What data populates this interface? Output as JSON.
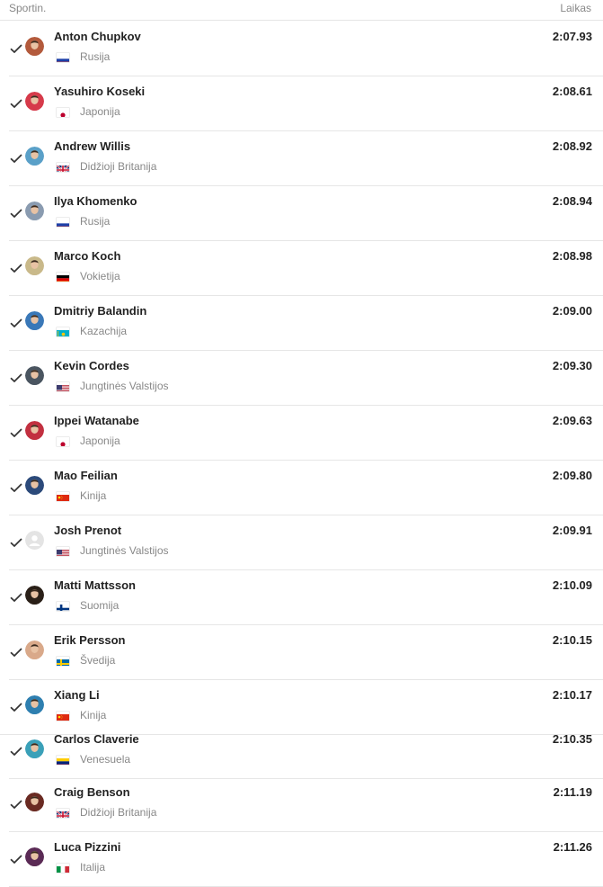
{
  "header": {
    "athlete_label": "Sportin.",
    "time_label": "Laikas"
  },
  "rows": [
    {
      "name": "Anton Chupkov",
      "country": "Rusija",
      "time": "2:07.93",
      "flag": "russia",
      "avatar_color": "#b35a3c",
      "avatar_icon": "athlete-photo-icon"
    },
    {
      "name": "Yasuhiro Koseki",
      "country": "Japonija",
      "time": "2:08.61",
      "flag": "japan",
      "avatar_color": "#d63a4a",
      "avatar_icon": "athlete-photo-icon"
    },
    {
      "name": "Andrew Willis",
      "country": "Didžioji Britanija",
      "time": "2:08.92",
      "flag": "uk",
      "avatar_color": "#5aa0c8",
      "avatar_icon": "athlete-photo-icon"
    },
    {
      "name": "Ilya Khomenko",
      "country": "Rusija",
      "time": "2:08.94",
      "flag": "russia",
      "avatar_color": "#8a9bb0",
      "avatar_icon": "athlete-photo-icon"
    },
    {
      "name": "Marco Koch",
      "country": "Vokietija",
      "time": "2:08.98",
      "flag": "germany",
      "avatar_color": "#c9b98a",
      "avatar_icon": "athlete-photo-icon"
    },
    {
      "name": "Dmitriy Balandin",
      "country": "Kazachija",
      "time": "2:09.00",
      "flag": "kazakhstan",
      "avatar_color": "#3a78b8",
      "avatar_icon": "athlete-photo-icon"
    },
    {
      "name": "Kevin Cordes",
      "country": "Jungtinės Valstijos",
      "time": "2:09.30",
      "flag": "usa",
      "avatar_color": "#4a5560",
      "avatar_icon": "athlete-photo-icon"
    },
    {
      "name": "Ippei Watanabe",
      "country": "Japonija",
      "time": "2:09.63",
      "flag": "japan",
      "avatar_color": "#c23040",
      "avatar_icon": "athlete-photo-icon"
    },
    {
      "name": "Mao Feilian",
      "country": "Kinija",
      "time": "2:09.80",
      "flag": "china",
      "avatar_color": "#2c4a7a",
      "avatar_icon": "athlete-photo-icon"
    },
    {
      "name": "Josh Prenot",
      "country": "Jungtinės Valstijos",
      "time": "2:09.91",
      "flag": "usa",
      "avatar_color": "#e2e2e2",
      "avatar_icon": "placeholder-avatar-icon"
    },
    {
      "name": "Matti Mattsson",
      "country": "Suomija",
      "time": "2:10.09",
      "flag": "finland",
      "avatar_color": "#2a2018",
      "avatar_icon": "athlete-photo-icon"
    },
    {
      "name": "Erik Persson",
      "country": "Švedija",
      "time": "2:10.15",
      "flag": "sweden",
      "avatar_color": "#d9a98a",
      "avatar_icon": "athlete-photo-icon"
    },
    {
      "name": "Xiang Li",
      "country": "Kinija",
      "time": "2:10.17",
      "flag": "china",
      "avatar_color": "#2e7fb0",
      "avatar_icon": "athlete-photo-icon"
    },
    {
      "name": "Carlos Claverie",
      "country": "Venesuela",
      "time": "2:10.35",
      "flag": "venezuela",
      "avatar_color": "#3aa0b8",
      "avatar_icon": "athlete-photo-icon"
    },
    {
      "name": "Craig Benson",
      "country": "Didžioji Britanija",
      "time": "2:11.19",
      "flag": "uk",
      "avatar_color": "#6a2a22",
      "avatar_icon": "athlete-photo-icon"
    },
    {
      "name": "Luca Pizzini",
      "country": "Italija",
      "time": "2:11.26",
      "flag": "italy",
      "avatar_color": "#5a2a55",
      "avatar_icon": "athlete-photo-icon"
    }
  ]
}
